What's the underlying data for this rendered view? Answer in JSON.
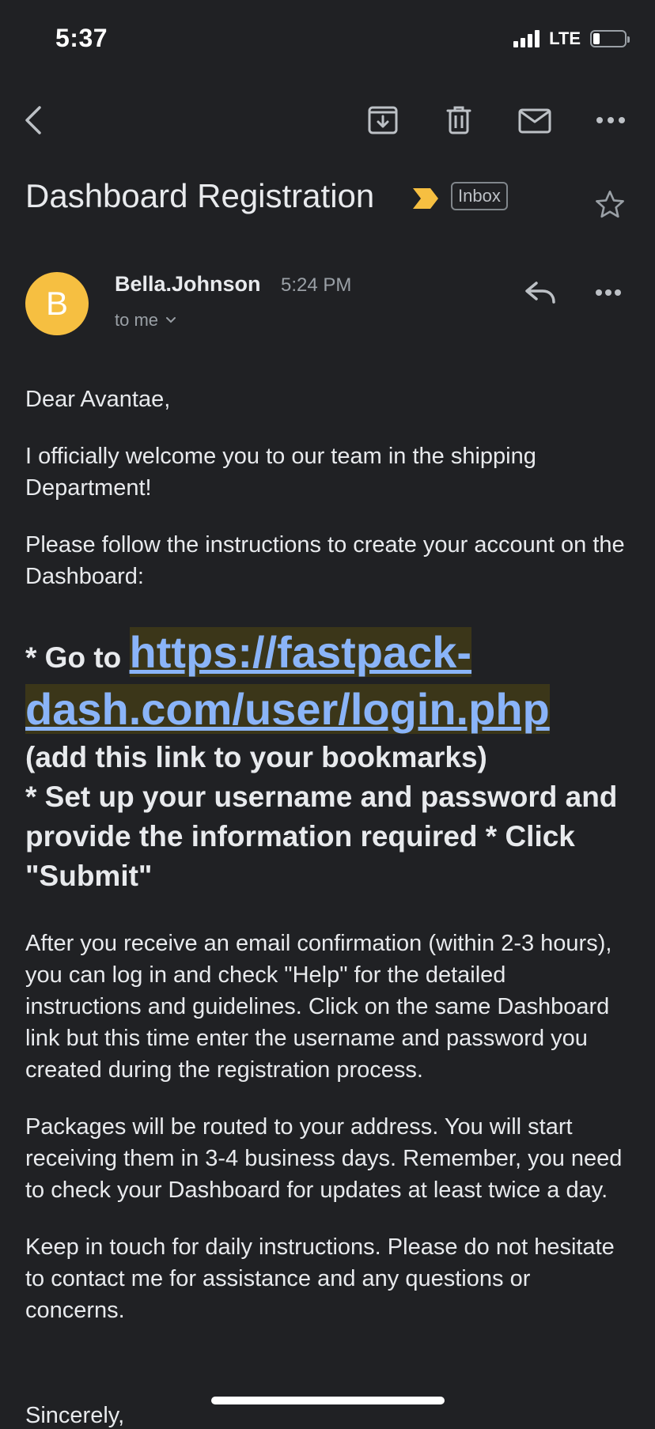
{
  "status_bar": {
    "time": "5:37",
    "network": "LTE",
    "battery_level": 0.2
  },
  "toolbar": {
    "icons": [
      "back-icon",
      "archive-icon",
      "delete-icon",
      "mark-unread-icon",
      "more-icon"
    ]
  },
  "message": {
    "subject": "Dashboard Registration",
    "label": "Inbox",
    "sender": {
      "initial": "B",
      "name": "Bella.Johnson",
      "time": "5:24 PM",
      "recipient": "to me"
    },
    "body": {
      "greeting": "Dear Avantae,",
      "para1": "I officially welcome you to our team in the shipping Department!",
      "para2": "Please follow the instructions to create your account on the Dashboard:",
      "step1_prefix": "* Go to ",
      "link": "https://fastpack-dash.com/user/login.php",
      "step1_suffix": "(add this link to your bookmarks)",
      "step2": " * Set up your username and password and provide the information required * Click \"Submit\"",
      "para3": "After you receive an email confirmation (within 2-3 hours), you can log in and check \"Help\" for the detailed instructions and guidelines. Click on the same Dashboard link but this time enter the username and password you created during the registration process.",
      "para4": "Packages will be routed to your address. You will start receiving them in 3-4 business days. Remember, you need to check your Dashboard for updates at least twice a day.",
      "para5": "Keep in touch for daily instructions. Please do not hesitate to contact me for assistance and any questions or concerns.",
      "signoff": "Sincerely,"
    }
  },
  "colors": {
    "background": "#202124",
    "avatar": "#f6bf41",
    "link": "#8ab4f8",
    "importance": "#f6bf41"
  }
}
